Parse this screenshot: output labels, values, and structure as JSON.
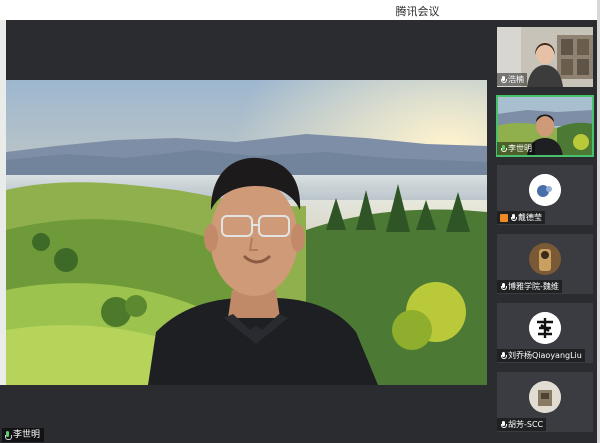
{
  "window": {
    "title": "腾讯会议"
  },
  "main_video": {
    "speaker_name": "李世明"
  },
  "participants": [
    {
      "name": "浩楠"
    },
    {
      "name": "李世明"
    },
    {
      "name": "戴德莹"
    },
    {
      "name": "博雅学院-魏维"
    },
    {
      "name": "刘乔杨QiaoyangLiu"
    },
    {
      "name": "胡芳-SCC"
    }
  ],
  "colors": {
    "active_outline": "#49c06b",
    "mic_active": "#5fd16c",
    "screen_share": "#f08a24",
    "app_background": "#2b2c30"
  }
}
